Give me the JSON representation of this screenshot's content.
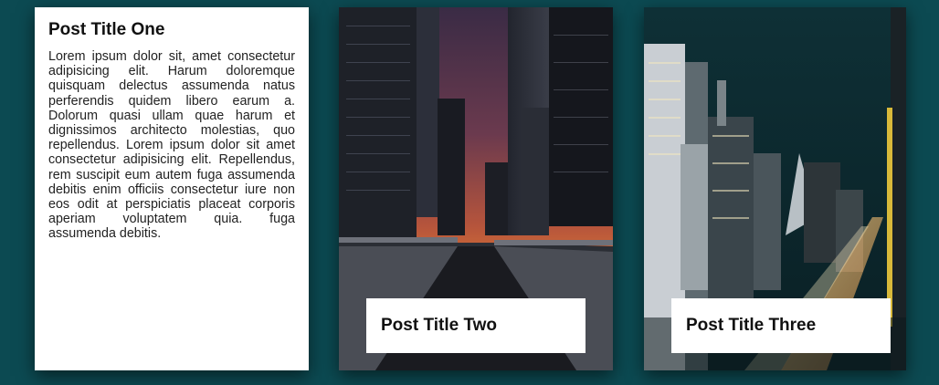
{
  "posts": [
    {
      "title": "Post Title One",
      "body": "Lorem ipsum dolor sit, amet consectetur adipisicing elit. Harum doloremque quisquam delectus assumenda natus perferendis quidem libero earum a. Dolorum quasi ullam quae harum et dignissimos architecto molestias, quo repellendus. Lorem ipsum dolor sit amet consectetur adipisicing elit. Repellendus, rem suscipit eum autem fuga assumenda debitis enim officiis consectetur iure non eos odit at perspiciatis placeat corporis aperiam voluptatem quia. fuga assumenda debitis."
    },
    {
      "title": "Post Title Two",
      "image": "city-sunset-bridge-photo"
    },
    {
      "title": "Post Title Three",
      "image": "city-night-traffic-photo"
    }
  ],
  "colors": {
    "background": "#0c4a52",
    "card": "#ffffff",
    "text": "#111111"
  }
}
